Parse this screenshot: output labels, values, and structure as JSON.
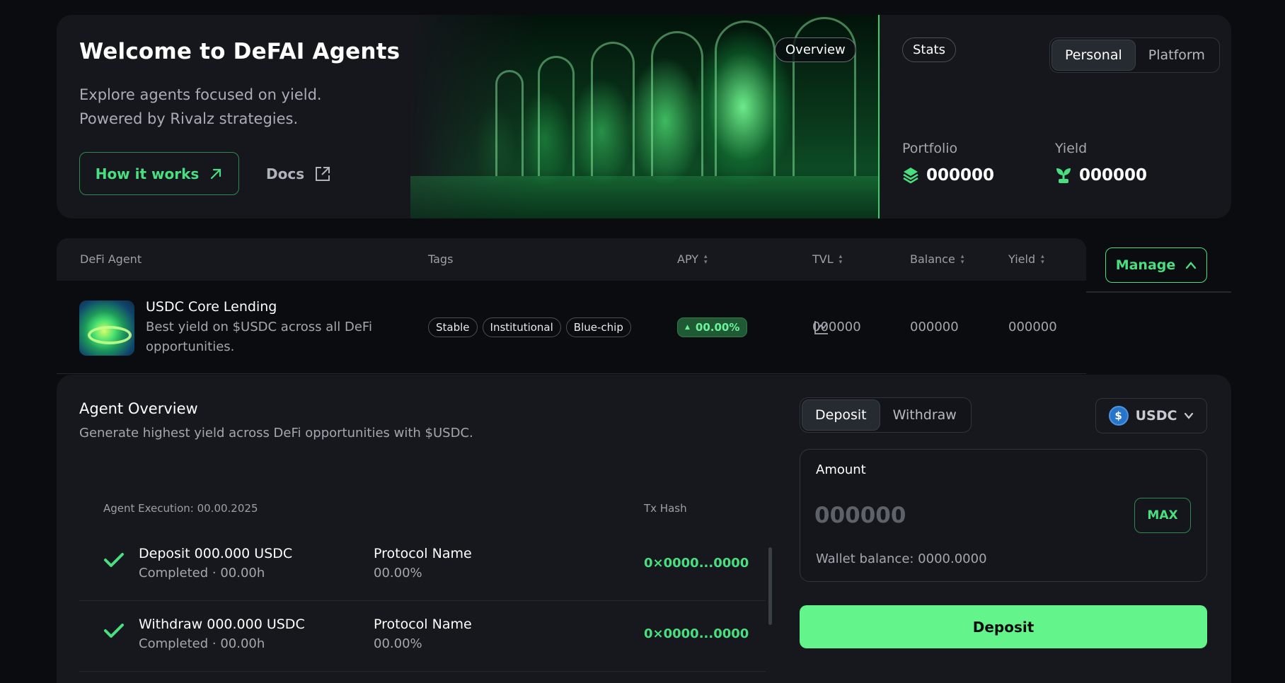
{
  "hero": {
    "title": "Welcome to DeFAI Agents",
    "subtitle_line1": "Explore agents focused on yield.",
    "subtitle_line2": "Powered by Rivalz strategies.",
    "how_it_works_label": "How it works",
    "docs_label": "Docs",
    "overview_badge": "Overview"
  },
  "stats": {
    "badge": "Stats",
    "tabs": [
      {
        "label": "Personal",
        "active": true
      },
      {
        "label": "Platform",
        "active": false
      }
    ],
    "portfolio_label": "Portfolio",
    "portfolio_value": "000000",
    "yield_label": "Yield",
    "yield_value": "000000"
  },
  "table": {
    "headers": {
      "agent": "DeFi Agent",
      "tags": "Tags",
      "apy": "APY",
      "tvl": "TVL",
      "balance": "Balance",
      "yield": "Yield"
    },
    "manage_label": "Manage",
    "row": {
      "name": "USDC Core Lending",
      "description": "Best yield on $USDC across all DeFi opportunities.",
      "tags": [
        "Stable",
        "Institutional",
        "Blue-chip"
      ],
      "apy": "00.00%",
      "tvl": "000000",
      "balance": "000000",
      "yield": "000000"
    }
  },
  "overview": {
    "title": "Agent Overview",
    "subtitle": "Generate highest yield across DeFi opportunities with $USDC.",
    "execution_label": "Agent Execution: 00.00.2025",
    "tx_hash_label": "Tx Hash",
    "executions": [
      {
        "title": "Deposit 000.000 USDC",
        "status": "Completed · 00.00h",
        "protocol": "Protocol Name",
        "pct": "00.00%",
        "hash": "0×0000...0000"
      },
      {
        "title": "Withdraw 000.000 USDC",
        "status": "Completed · 00.00h",
        "protocol": "Protocol Name",
        "pct": "00.00%",
        "hash": "0×0000...0000"
      }
    ]
  },
  "action": {
    "tabs": [
      {
        "label": "Deposit",
        "active": true
      },
      {
        "label": "Withdraw",
        "active": false
      }
    ],
    "coin": "USDC",
    "amount_label": "Amount",
    "amount_placeholder": "000000",
    "max_label": "MAX",
    "wallet_balance": "Wallet balance: 0000.0000",
    "submit_label": "Deposit"
  },
  "colors": {
    "accent": "#4ade80",
    "accent_button": "#63f58b",
    "background": "#0b0c10",
    "card": "#16181d"
  }
}
